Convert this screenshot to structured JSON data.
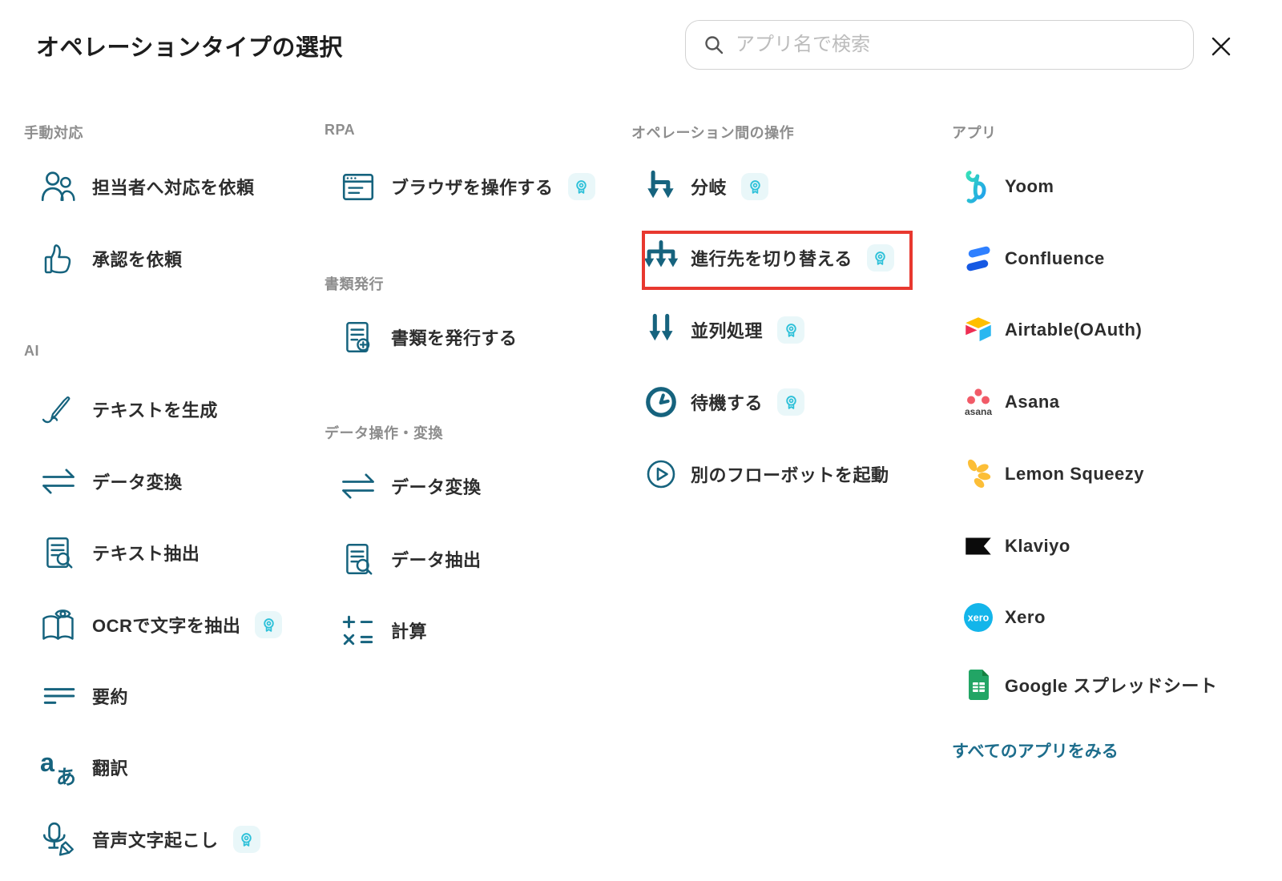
{
  "header": {
    "title": "オペレーションタイプの選択"
  },
  "search": {
    "placeholder": "アプリ名で検索"
  },
  "colors": {
    "icon_teal": "#16637e",
    "badge_cyan": "#2ec1d9",
    "highlight_red": "#e8382f",
    "link_teal": "#1d6d8c"
  },
  "col_manual": {
    "title": "手動対応",
    "items": {
      "request_staff": "担当者へ対応を依頼",
      "request_approval": "承認を依頼"
    }
  },
  "col_ai": {
    "title": "AI",
    "items": {
      "generate_text": "テキストを生成",
      "convert_data": "データ変換",
      "extract_text": "テキスト抽出",
      "ocr": "OCRで文字を抽出",
      "summarize": "要約",
      "translate": "翻訳",
      "transcribe": "音声文字起こし"
    }
  },
  "col_rpa": {
    "title": "RPA",
    "items": {
      "operate_browser": "ブラウザを操作する"
    }
  },
  "col_docs": {
    "title": "書類発行",
    "items": {
      "issue_document": "書類を発行する"
    }
  },
  "col_dataops": {
    "title": "データ操作・変換",
    "items": {
      "convert_data": "データ変換",
      "extract_data": "データ抽出",
      "calculate": "計算"
    }
  },
  "col_flow": {
    "title": "オペレーション間の操作",
    "items": {
      "branch": "分岐",
      "switch_path": "進行先を切り替える",
      "parallel": "並列処理",
      "wait": "待機する",
      "launch_flowbot": "別のフローボットを起動"
    }
  },
  "col_apps": {
    "title": "アプリ",
    "items": {
      "yoom": "Yoom",
      "confluence": "Confluence",
      "airtable": "Airtable(OAuth)",
      "asana": "Asana",
      "lemon_squeezy": "Lemon Squeezy",
      "klaviyo": "Klaviyo",
      "xero": "Xero",
      "google_sheets": "Google スプレッドシート"
    },
    "asana_wordmark": "asana",
    "xero_wordmark": "xero",
    "view_all": "すべてのアプリをみる"
  }
}
